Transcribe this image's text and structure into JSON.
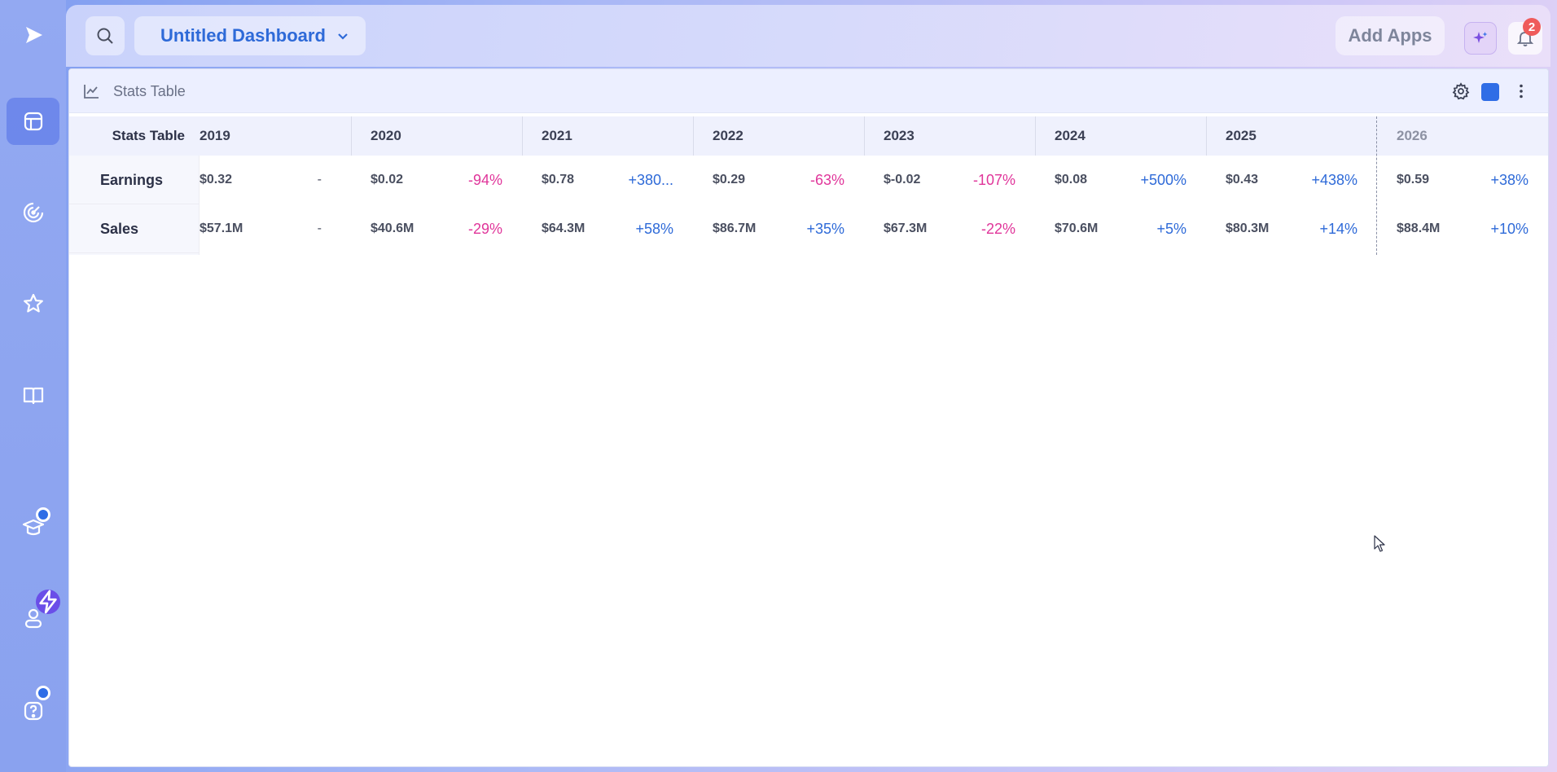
{
  "topbar": {
    "dashboard_name": "Untitled Dashboard",
    "add_apps_label": "Add Apps",
    "notification_count": "2"
  },
  "sidebar": {
    "items": [
      {
        "icon": "logo-play-icon"
      },
      {
        "icon": "dashboard-icon",
        "active": true
      },
      {
        "icon": "radar-icon"
      },
      {
        "icon": "star-icon"
      },
      {
        "icon": "book-icon"
      },
      {
        "icon": "graduation-cap-icon",
        "badge": "dot"
      },
      {
        "icon": "user-icon",
        "badge": "bolt"
      },
      {
        "icon": "help-icon",
        "badge": "dot"
      }
    ]
  },
  "panel": {
    "title": "Stats Table"
  },
  "table": {
    "corner_label": "Stats Table",
    "years": [
      "2019",
      "2020",
      "2021",
      "2022",
      "2023",
      "2024",
      "2025",
      "2026"
    ],
    "rows": [
      {
        "label": "Earnings",
        "values": [
          "$0.32",
          "$0.02",
          "$0.78",
          "$0.29",
          "$-0.02",
          "$0.08",
          "$0.43",
          "$0.59"
        ],
        "changes": [
          "-",
          "-94%",
          "+380...",
          "-63%",
          "-107%",
          "+500%",
          "+438%",
          "+38%"
        ]
      },
      {
        "label": "Sales",
        "values": [
          "$57.1M",
          "$40.6M",
          "$64.3M",
          "$86.7M",
          "$67.3M",
          "$70.6M",
          "$80.3M",
          "$88.4M"
        ],
        "changes": [
          "-",
          "-29%",
          "+58%",
          "+35%",
          "-22%",
          "+5%",
          "+14%",
          "+10%"
        ]
      }
    ]
  },
  "colors": {
    "accent": "#2f6de6",
    "positive": "#2e6ad8",
    "negative": "#e0359a",
    "notification": "#ef5b5b"
  }
}
